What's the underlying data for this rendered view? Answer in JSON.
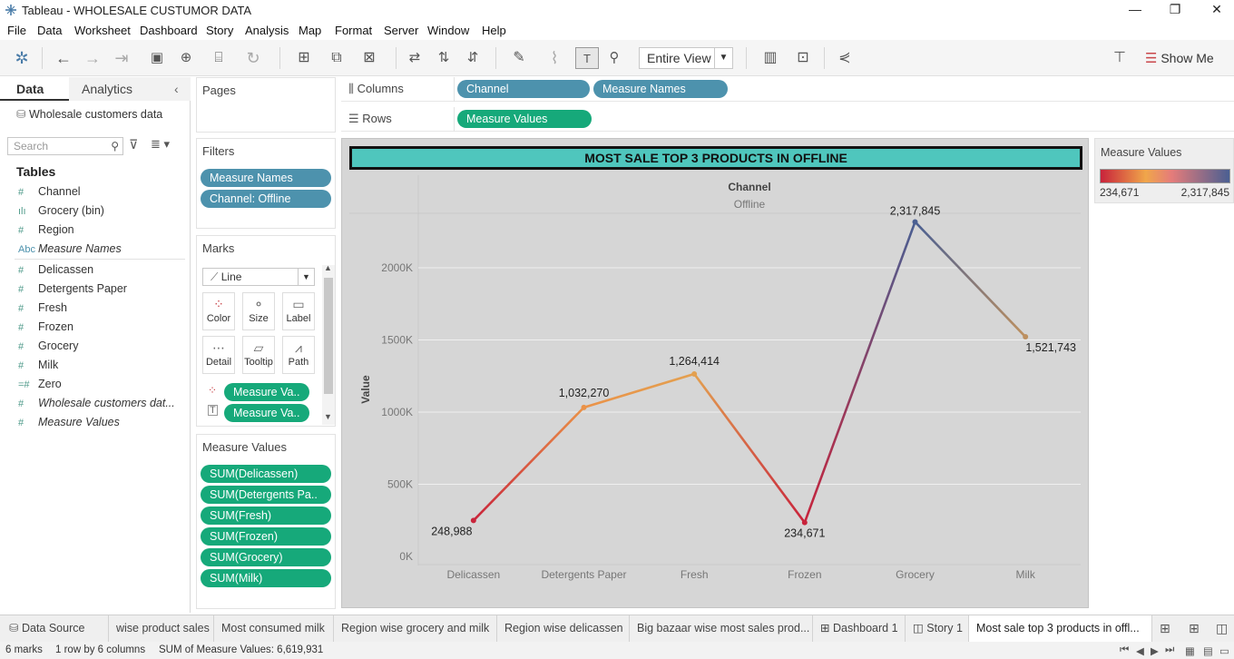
{
  "window": {
    "title": "Tableau - WHOLESALE CUSTUMOR DATA",
    "minimize": "—",
    "restore": "❐",
    "close": "✕"
  },
  "menu": [
    "File",
    "Data",
    "Worksheet",
    "Dashboard",
    "Story",
    "Analysis",
    "Map",
    "Format",
    "Server",
    "Window",
    "Help"
  ],
  "toolbar": {
    "view_select": "Entire View",
    "show_me": "Show Me"
  },
  "data_pane": {
    "tabs": {
      "data": "Data",
      "analytics": "Analytics"
    },
    "source": "Wholesale customers data",
    "search_placeholder": "Search",
    "tables_header": "Tables",
    "fields": [
      {
        "icon": "#",
        "name": "Channel",
        "italic": false
      },
      {
        "icon": "ılı",
        "name": "Grocery (bin)",
        "italic": false
      },
      {
        "icon": "#",
        "name": "Region",
        "italic": false
      },
      {
        "icon": "Abc",
        "name": "Measure Names",
        "italic": true
      },
      {
        "icon": "#",
        "name": "Delicassen",
        "italic": false
      },
      {
        "icon": "#",
        "name": "Detergents Paper",
        "italic": false
      },
      {
        "icon": "#",
        "name": "Fresh",
        "italic": false
      },
      {
        "icon": "#",
        "name": "Frozen",
        "italic": false
      },
      {
        "icon": "#",
        "name": "Grocery",
        "italic": false
      },
      {
        "icon": "#",
        "name": "Milk",
        "italic": false
      },
      {
        "icon": "=#",
        "name": "Zero",
        "italic": false
      },
      {
        "icon": "#",
        "name": "Wholesale customers dat...",
        "italic": true
      },
      {
        "icon": "#",
        "name": "Measure Values",
        "italic": true
      }
    ]
  },
  "pages": {
    "header": "Pages"
  },
  "filters": {
    "header": "Filters",
    "items": [
      "Measure Names",
      "Channel: Offline"
    ]
  },
  "marks": {
    "header": "Marks",
    "type": "Line",
    "buttons": [
      "Color",
      "Size",
      "Label",
      "Detail",
      "Tooltip",
      "Path"
    ],
    "encodings": [
      "Measure Va..",
      "Measure Va.."
    ]
  },
  "measure_values_card": {
    "header": "Measure Values",
    "items": [
      "SUM(Delicassen)",
      "SUM(Detergents Pa..",
      "SUM(Fresh)",
      "SUM(Frozen)",
      "SUM(Grocery)",
      "SUM(Milk)"
    ]
  },
  "shelves": {
    "columns_label": "Columns",
    "columns": [
      "Channel",
      "Measure Names"
    ],
    "rows_label": "Rows",
    "rows": [
      "Measure Values"
    ]
  },
  "legend": {
    "title": "Measure Values",
    "min_label": "234,671",
    "max_label": "2,317,845"
  },
  "chart_data": {
    "type": "line",
    "title": "MOST SALE TOP 3 PRODUCTS IN OFFLINE",
    "column_header": "Channel",
    "column_value": "Offline",
    "ylabel": "Value",
    "categories": [
      "Delicassen",
      "Detergents Paper",
      "Fresh",
      "Frozen",
      "Grocery",
      "Milk"
    ],
    "values": [
      248988,
      1032270,
      1264414,
      234671,
      2317845,
      1521743
    ],
    "value_labels": [
      "248,988",
      "1,032,270",
      "1,264,414",
      "234,671",
      "2,317,845",
      "1,521,743"
    ],
    "yticks": [
      0,
      500000,
      1000000,
      1500000,
      2000000
    ],
    "ytick_labels": [
      "0K",
      "500K",
      "1000K",
      "1500K",
      "2000K"
    ],
    "ylim": [
      0,
      2600000
    ],
    "color_range": [
      "#c8233b",
      "#f0a64a",
      "#4a5f92"
    ],
    "grid": true
  },
  "sheet_tabs": {
    "data_source": "Data Source",
    "tabs": [
      "wise product sales",
      "Most consumed milk",
      "Region wise grocery and milk",
      "Region wise delicassen",
      "Big bazaar wise most sales prod...",
      "Dashboard 1",
      "Story 1",
      "Most sale top 3 products in offl..."
    ]
  },
  "status": {
    "marks": "6 marks",
    "rows": "1 row by 6 columns",
    "sum": "SUM of Measure Values: 6,619,931"
  }
}
